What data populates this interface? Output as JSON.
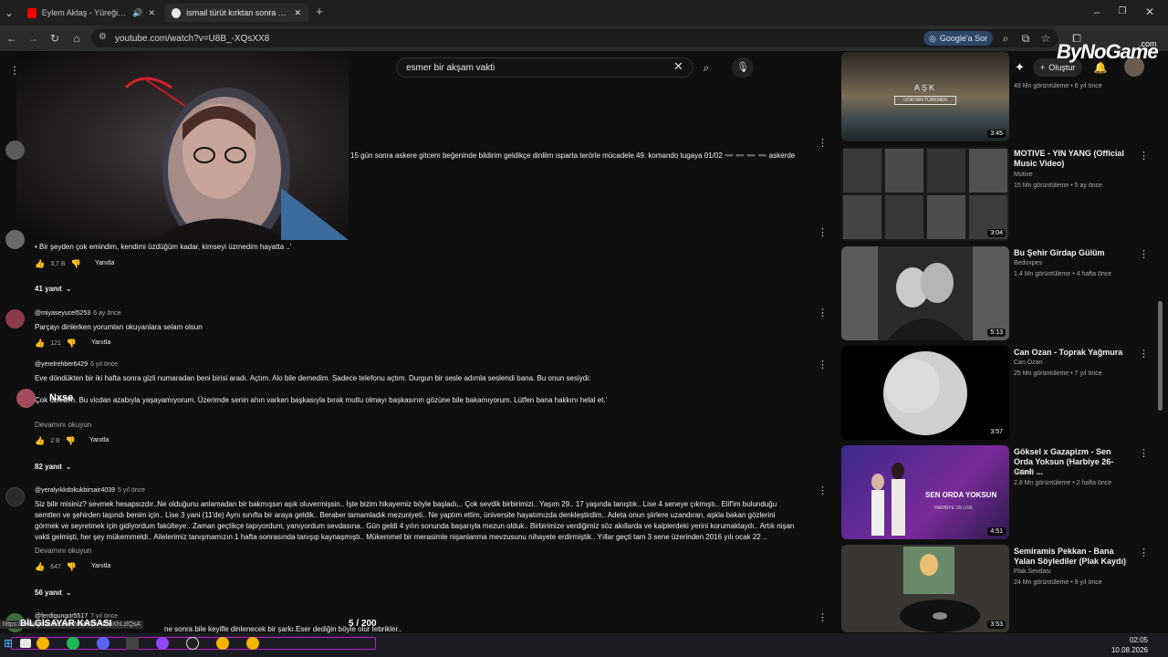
{
  "browser": {
    "tabs": [
      {
        "title": "Eylem Aktaş - Yüreğimden",
        "active": false
      },
      {
        "title": "ismail türüt kırktan sonra şarkı",
        "active": true
      }
    ],
    "new_tab": "+",
    "url": "youtube.com/watch?v=U8B_-XQsXX8",
    "google_button": "Google'a Sor"
  },
  "youtube": {
    "search_query": "esmer bir akşam vakti",
    "create_label": "Oluştur"
  },
  "watermark": {
    "brand": "ByNoGame",
    "suffix": ".com"
  },
  "comments": [
    {
      "handle": "",
      "when": "",
      "lines": [
        "15 gün sonra askere gitcem beğeninde bildirim geldikçe dinliim ısparta terörle mücadele 49. komando tugaya 01/02 ➖ ➖ ➖ ➖ askerde"
      ],
      "likes": "",
      "reply": "",
      "replies": "",
      "more": ""
    },
    {
      "handle": "",
      "when": "",
      "lines": [
        "• Bir şeyden çok emindim, kendimi üzdüğüm kadar, kimseyi üzmedim hayatta ..'"
      ],
      "likes": "3,7 B",
      "reply": "Yanıtla",
      "replies": "41 yanıt",
      "more": ""
    },
    {
      "handle": "@miyaseyucel5253",
      "when": "6 ay önce",
      "lines": [
        "Parçayı dinlerken yorumları okuyanlara selam olsun"
      ],
      "likes": "121",
      "reply": "Yanıtla",
      "replies": "",
      "more": ""
    },
    {
      "handle": "@yerelrehber6429",
      "when": "6 yıl önce",
      "lines": [
        "Eve döndükten bir iki hafta sonra gizli numaradan beni birisi aradı. Açtım. Alo bile demedim. Sadece telefonu açtım. Durgun bir sesle adımla seslendi bana. Bu onun sesiydi:",
        "",
        "Çok özledim. Bu vicdan azabıyla yaşayamıyorum. Üzerimde senin ahın varken başkasıyla bırak mutlu olmayı başkasının gözüne bile bakamıyorum. Lütfen bana hakkını helal et.'"
      ],
      "likes": "2 B",
      "reply": "Yanıtla",
      "replies": "82 yanıt",
      "more": "Devamını okuyun"
    },
    {
      "handle": "@yeralyıkkdokukbirsair4039",
      "when": "5 yıl önce",
      "lines": [
        "Siz bilir misiniz? sevmek hesapsızdır..Ne olduğunu anlamadan bir bakmışsın aşık oluvermişsin.. İşte bizim hikayemiz böyle başladı,.. Çok sevdik birbirimizi.. Yaşım 29.. 17 yaşında tanıştık.. Lise 4 seneye çıkmıştı.. Elif'im bulunduğu",
        "semtten ve şehirden taşındı benim için.. Lise 3 yani (11'de) Aynı sınıfta bir araya geldik.. Beraber tamamladık mezuniyeti.. Ne yaptım ettim, üniversite hayatımızda denkleştirdim.. Adeta onun şiirlere uzandıran, aşkla bakan gözlerini",
        "görmek ve seyretmek için gidiyordum fakülteye.. Zaman geçtikçe tapıyordum, yanıyordum sevdasına.. Gün geldi 4 yılın sonunda başarıyla mezun olduk.. Birbirimize verdiğimiz söz akıllarda ve kalplerdeki yerini korumaktaydı.. Artık nişan",
        "vakti gelmişti, her şey mükemmeldi.. Ailelerimiz tanışmamızın 1 hafta sonrasında tanışıp kaynaşmıştı.. Mükemmel bir merasimle nişanlanma mevzusunu nihayete erdirmiştik.. Yıllar geçti tam 3 sene üzerinden 2016 yılı ocak 22 .."
      ],
      "likes": "647",
      "reply": "Yanıtla",
      "replies": "56 yanıt",
      "more": "Devamını okuyun"
    },
    {
      "handle": "@ferdigungor5517",
      "when": "7 yıl önce",
      "lines": [
        "ne sonra bile keyifle dinlenecek bir şarkı.Eser dediğin böyle olur tebrikler.."
      ],
      "likes": "",
      "reply": "",
      "replies": "",
      "more": ""
    }
  ],
  "recommendations": [
    {
      "title": "",
      "channel": "",
      "meta": "49 Mn görüntüleme • 6 yıl önce",
      "duration": "3:45",
      "thumb_text": "AŞK",
      "thumb_sub": "GÖKHAN TÜRKMEN"
    },
    {
      "title": "MOTIVE - YIN YANG (Official Music Video)",
      "channel": "Motive",
      "meta": "15 Mn görüntüleme • 5 ay önce",
      "duration": "3:04"
    },
    {
      "title": "Bu Şehir Girdap Gülüm",
      "channel": "Bedoxpes",
      "meta": "1,4 Mn görüntüleme • 4 hafta önce",
      "duration": "5:13"
    },
    {
      "title": "Can Ozan - Toprak Yağmura",
      "channel": "Can Ozan",
      "meta": "25 Mn görüntüleme • 7 yıl önce",
      "duration": "3:57"
    },
    {
      "title": "Göksel x Gazapizm - Sen Orda Yoksun (Harbiye 26- Canlı ...",
      "channel": "Göksel",
      "meta": "2,8 Mn görüntüleme • 2 hafta önce",
      "duration": "4:51",
      "thumb_text": "SEN ORDA YOKSUN",
      "thumb_sub": "HARBİYE '26 LIVE"
    },
    {
      "title": "Semiramis Pekkan - Bana Yalan Söylediler (Plak Kaydı)",
      "channel": "Plak Sevdası",
      "meta": "24 Mn görüntüleme • 9 yıl önce",
      "duration": "3:53"
    }
  ],
  "overlay": {
    "label": "BİLGİSAYAR KASASI",
    "counter": "5 / 200",
    "name": "Nxse",
    "status_url": "https://www.youtube.com/watch?v=lDpXhLzlQsA"
  },
  "taskbar": {
    "time": "02:05",
    "date": "10.08.2026"
  },
  "colors": {
    "accent": "#c11ad1",
    "youtube_red": "#ff0000",
    "background": "#0f0f0f"
  }
}
